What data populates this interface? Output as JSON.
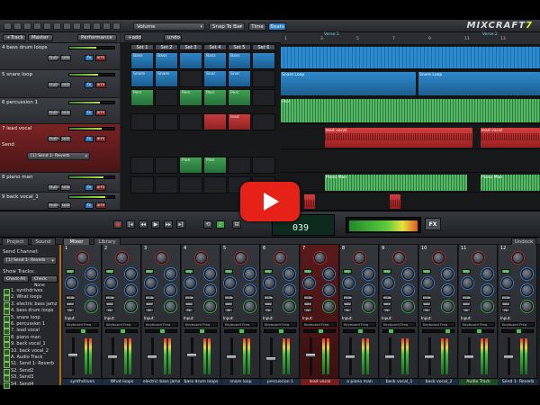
{
  "toolbar": {
    "volume_dd": "Volume",
    "snap_dd": "Snap To Bar",
    "time_btn": "Time",
    "beats_btn": "Beats",
    "logo_text": "MIXCRAFT",
    "logo_ver": "7"
  },
  "tracklist": {
    "header": {
      "track_btn": "+Track",
      "master_btn": "Master",
      "perf_btn": "Performance"
    },
    "tracks": [
      {
        "num": "4 bass drum loops",
        "label": ""
      },
      {
        "num": "5 snare loop",
        "label": ""
      },
      {
        "num": "6 percussion 1",
        "label": ""
      },
      {
        "num": "7 lead vocal",
        "label": "",
        "send_label": "Send",
        "send_value": "[1] Send 1- Reverb"
      },
      {
        "num": "8 piano man",
        "label": ""
      },
      {
        "num": "9 back vocal_1",
        "label": ""
      }
    ],
    "btn_mute": "mute",
    "btn_solo": "solo",
    "btn_arm": "arm",
    "btn_fx": "fx"
  },
  "clipgrid": {
    "add_label": "+add",
    "undo_label": "undo",
    "set_labels": [
      "Set 1",
      "Set 2",
      "Set 3",
      "Set 4",
      "Set 5",
      "Set 6"
    ],
    "clips": [
      {
        "row": 0,
        "col": 0,
        "color": "blue",
        "text": "Bass"
      },
      {
        "row": 0,
        "col": 1,
        "color": "blue",
        "text": "Bass"
      },
      {
        "row": 0,
        "col": 2,
        "color": "blue",
        "text": ""
      },
      {
        "row": 0,
        "col": 3,
        "color": "blue",
        "text": "Bass"
      },
      {
        "row": 0,
        "col": 4,
        "color": "blue",
        "text": "Bass"
      },
      {
        "row": 0,
        "col": 5,
        "color": "blue",
        "text": ""
      },
      {
        "row": 1,
        "col": 0,
        "color": "blue",
        "text": "Snare"
      },
      {
        "row": 1,
        "col": 1,
        "color": "blue",
        "text": "Snare"
      },
      {
        "row": 1,
        "col": 3,
        "color": "blue",
        "text": "Snar"
      },
      {
        "row": 1,
        "col": 4,
        "color": "blue",
        "text": "Snar"
      },
      {
        "row": 2,
        "col": 0,
        "color": "green",
        "text": "Perc"
      },
      {
        "row": 2,
        "col": 2,
        "color": "green",
        "text": "Perc"
      },
      {
        "row": 2,
        "col": 3,
        "color": "green",
        "text": "Perc"
      },
      {
        "row": 2,
        "col": 4,
        "color": "green",
        "text": "Perc"
      },
      {
        "row": 3,
        "col": 3,
        "color": "red",
        "text": ""
      },
      {
        "row": 3,
        "col": 4,
        "color": "red",
        "text": "lead"
      },
      {
        "row": 4,
        "col": 2,
        "color": "green",
        "text": "Pian"
      },
      {
        "row": 4,
        "col": 3,
        "color": "green",
        "text": "Pian"
      }
    ]
  },
  "arrangement": {
    "markers": [
      "Verse 1",
      "Verse 2"
    ],
    "ruler_numbers": [
      "1",
      "3",
      "5",
      "7",
      "9",
      "11",
      "13"
    ],
    "lane_clips": [
      {
        "lane": 0,
        "color": "blue",
        "text": "",
        "start": 0.0,
        "end": 1.0
      },
      {
        "lane": 1,
        "color": "blue2",
        "text": "Snare Loop",
        "start": 0.0,
        "end": 0.52
      },
      {
        "lane": 1,
        "color": "blue2",
        "text": "Snare Loop",
        "start": 0.53,
        "end": 1.0
      },
      {
        "lane": 2,
        "color": "green",
        "text": "Perc",
        "start": 0.0,
        "end": 1.0
      },
      {
        "lane": 3,
        "color": "red",
        "text": "lead vocal",
        "start": 0.17,
        "end": 0.74
      },
      {
        "lane": 3,
        "color": "red",
        "text": "lead vocal",
        "start": 0.77,
        "end": 1.0
      },
      {
        "lane": 5,
        "color": "green",
        "text": "Piano Man",
        "start": 0.17,
        "end": 0.72
      },
      {
        "lane": 5,
        "color": "green",
        "text": "Piano Man",
        "start": 0.77,
        "end": 1.0
      },
      {
        "lane": 6,
        "color": "red",
        "text": "",
        "start": 0.09,
        "end": 0.13
      },
      {
        "lane": 6,
        "color": "red",
        "text": "",
        "start": 0.42,
        "end": 0.46
      }
    ]
  },
  "transport": {
    "lcd_top": "4",
    "lcd_big": "039",
    "fx_label": "FX"
  },
  "bottom_tabs": [
    "Project",
    "Sound",
    "Mixer",
    "Library"
  ],
  "undock_label": "Undock",
  "mixleft": {
    "send_channel_label": "Send Channel:",
    "send_channel_value": "[1] Send 1- Reverb",
    "show_tracks_label": "Show Tracks:",
    "check_all": "Check All",
    "check_none": "Check None",
    "track_list": [
      "1. synthdrives",
      "2. What loops",
      "3. electric bass jamz",
      "4. bass drum loops",
      "5. snare loop",
      "6. percussion 1",
      "7. lead vocal",
      "8. piano man",
      "9. back vocal_1",
      "10. back vocal_2",
      "A. Audio Track",
      "S1. Send 1- Reverb",
      "S2. Send2",
      "S3. Send3",
      "S4. Send4"
    ]
  },
  "strips": [
    {
      "num": "1",
      "name": "synthdrives",
      "pan": 0.5,
      "fader": 0.55,
      "style": "normal"
    },
    {
      "num": "2",
      "name": "What loops",
      "pan": 0.5,
      "fader": 0.5,
      "style": "normal"
    },
    {
      "num": "3",
      "name": "electric bass jamz",
      "pan": 0.5,
      "fader": 0.5,
      "style": "normal"
    },
    {
      "num": "4",
      "name": "bass drum loops",
      "pan": 0.5,
      "fader": 0.55,
      "style": "normal"
    },
    {
      "num": "5",
      "name": "snare loop",
      "pan": 0.5,
      "fader": 0.5,
      "style": "normal"
    },
    {
      "num": "6",
      "name": "percussion 1",
      "pan": 0.5,
      "fader": 0.45,
      "style": "normal"
    },
    {
      "num": "7",
      "name": "lead vocal",
      "pan": 0.5,
      "fader": 0.55,
      "style": "sel"
    },
    {
      "num": "8",
      "name": "a piano man",
      "pan": 0.5,
      "fader": 0.5,
      "style": "normal"
    },
    {
      "num": "9",
      "name": "back vocal_1",
      "pan": 0.2,
      "fader": 0.5,
      "style": "normal"
    },
    {
      "num": "10",
      "name": "back vocal_2",
      "pan": 0.8,
      "fader": 0.5,
      "style": "normal"
    },
    {
      "num": "11",
      "name": "Audio Track",
      "pan": 0.5,
      "fader": 0.5,
      "style": "grn"
    },
    {
      "num": "12",
      "name": "Send 1- Reverb",
      "pan": 0.5,
      "fader": 0.5,
      "style": "normal"
    }
  ],
  "strip_labels": {
    "input": "Input:",
    "input_value": "Keyboard Freq",
    "mute": "mute",
    "solo": "solo",
    "arm": "arm",
    "fx": "fx",
    "eq": "EQ"
  }
}
